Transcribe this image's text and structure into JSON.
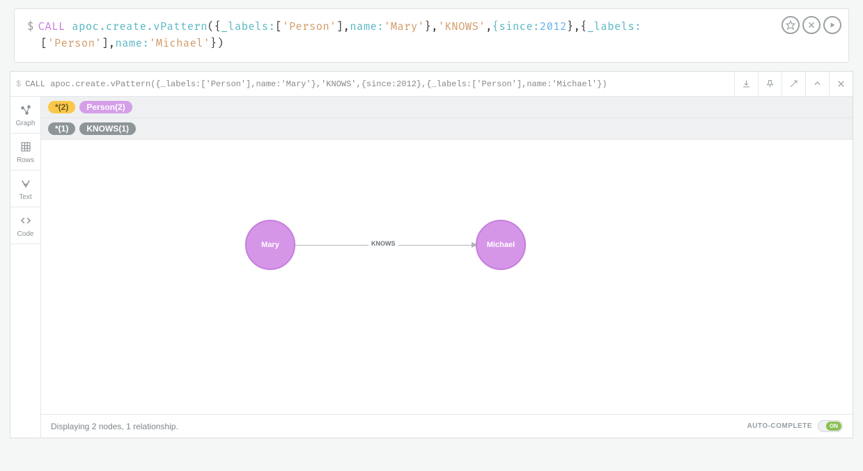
{
  "editor": {
    "prompt": "$",
    "segments": [
      {
        "t": "CALL",
        "c": "kw"
      },
      {
        "t": " ",
        "c": ""
      },
      {
        "t": "apoc.create.vPattern",
        "c": "fn"
      },
      {
        "t": "({",
        "c": "brace"
      },
      {
        "t": "_labels:",
        "c": "fn"
      },
      {
        "t": "[",
        "c": "brace"
      },
      {
        "t": "'Person'",
        "c": "str2"
      },
      {
        "t": "],",
        "c": "brace"
      },
      {
        "t": "name:",
        "c": "fn"
      },
      {
        "t": "'Mary'",
        "c": "str2"
      },
      {
        "t": "},",
        "c": "brace"
      },
      {
        "t": "'KNOWS'",
        "c": "str2"
      },
      {
        "t": ",",
        "c": "brace"
      },
      {
        "t": "{since:",
        "c": "fn"
      },
      {
        "t": "2012",
        "c": "num"
      },
      {
        "t": "},{",
        "c": "brace"
      },
      {
        "t": "_labels:",
        "c": "fn"
      }
    ],
    "line2": [
      {
        "t": "[",
        "c": "brace"
      },
      {
        "t": "'Person'",
        "c": "str2"
      },
      {
        "t": "],",
        "c": "brace"
      },
      {
        "t": "name:",
        "c": "fn"
      },
      {
        "t": "'Michael'",
        "c": "str2"
      },
      {
        "t": "})",
        "c": "brace"
      }
    ]
  },
  "result_header": {
    "prompt": "$",
    "query": "CALL apoc.create.vPattern({_labels:['Person'],name:'Mary'},'KNOWS',{since:2012},{_labels:['Person'],name:'Michael'})"
  },
  "views": {
    "graph": "Graph",
    "rows": "Rows",
    "text": "Text",
    "code": "Code"
  },
  "tags": {
    "star2": "*(2)",
    "person2": "Person(2)",
    "star1": "*(1)",
    "knows1": "KNOWS(1)"
  },
  "graph": {
    "node1": "Mary",
    "node2": "Michael",
    "edge_label": "KNOWS"
  },
  "footer": {
    "status": "Displaying 2 nodes, 1 relationship.",
    "autocomplete_label": "AUTO-COMPLETE",
    "toggle_state": "ON"
  }
}
